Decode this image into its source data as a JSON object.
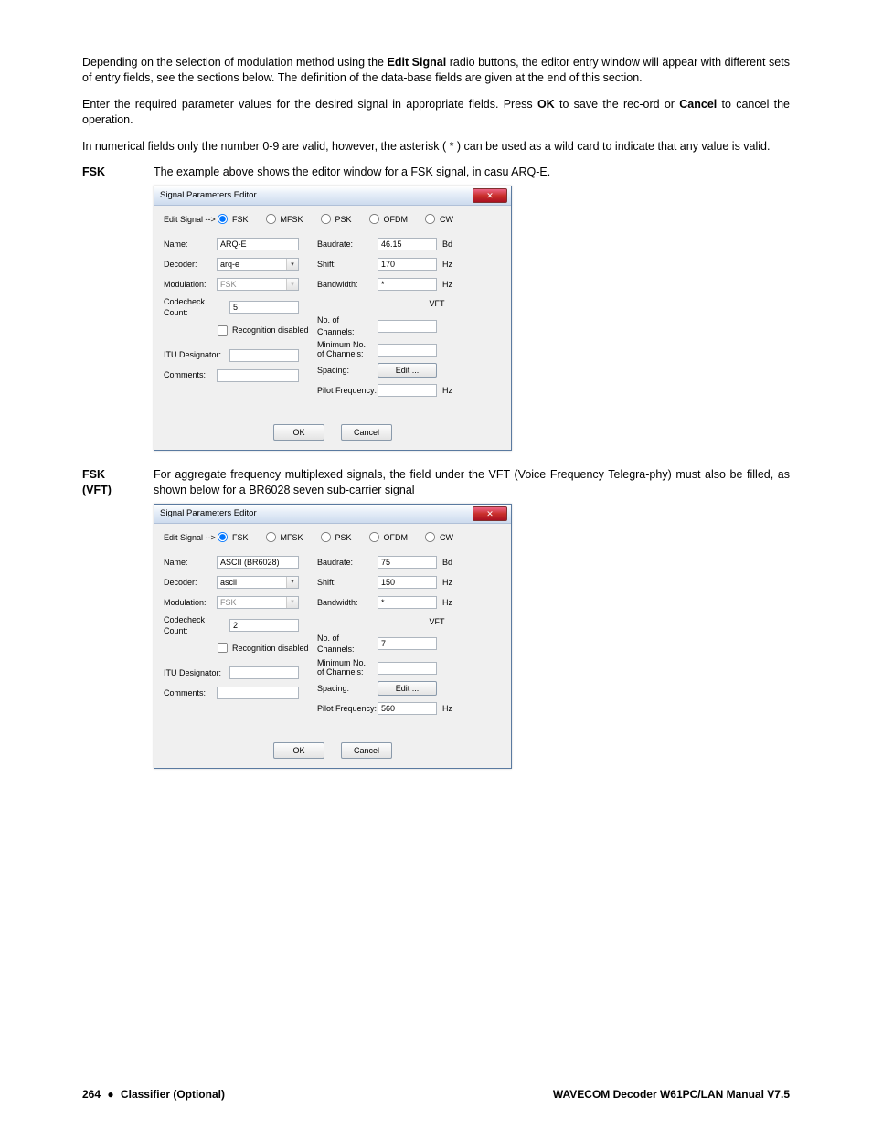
{
  "paragraphs": {
    "p1_a": "Depending on the selection of modulation method using the ",
    "p1_b": "Edit Signal",
    "p1_c": " radio buttons, the editor entry window will appear with different sets of entry fields, see the sections below. The definition of the data-base fields are given at the end of this section.",
    "p2_a": "Enter the required parameter values for the desired signal in appropriate fields. Press ",
    "p2_b": "OK",
    "p2_c": " to save the rec-ord or ",
    "p2_d": "Cancel",
    "p2_e": " to cancel the operation.",
    "p3": "In numerical fields only the number 0-9 are valid, however,  the asterisk ( * ) can be used as a wild card to indicate that any value is valid."
  },
  "sections": {
    "fsk_label": "FSK",
    "fsk_text": "The example above shows the editor window for a FSK signal, in casu ARQ-E.",
    "vft_label1": "FSK",
    "vft_label2": "(VFT)",
    "vft_text": "For aggregate frequency multiplexed signals, the field under the VFT (Voice Frequency Telegra-phy) must also be filled, as shown below for a BR6028 seven sub-carrier signal"
  },
  "dialog_labels": {
    "title": "Signal Parameters Editor",
    "edit_signal": "Edit Signal -->",
    "radio_fsk": "FSK",
    "radio_mfsk": "MFSK",
    "radio_psk": "PSK",
    "radio_ofdm": "OFDM",
    "radio_cw": "CW",
    "name": "Name:",
    "decoder": "Decoder:",
    "modulation": "Modulation:",
    "codecheck": "Codecheck Count:",
    "recognition": "Recognition disabled",
    "itu": "ITU Designator:",
    "comments": "Comments:",
    "baudrate": "Baudrate:",
    "shift": "Shift:",
    "bandwidth": "Bandwidth:",
    "vft": "VFT",
    "channels": "No. of Channels:",
    "minchannels1": "Minimum No.",
    "minchannels2": "of Channels:",
    "spacing": "Spacing:",
    "pilot": "Pilot Frequency:",
    "edit_btn": "Edit ...",
    "ok": "OK",
    "cancel": "Cancel",
    "unit_bd": "Bd",
    "unit_hz": "Hz"
  },
  "dialog1": {
    "name": "ARQ-E",
    "decoder": "arq-e",
    "modulation": "FSK",
    "codecheck": "5",
    "itu": "",
    "comments": "",
    "baudrate": "46.15",
    "shift": "170",
    "bandwidth": "*",
    "channels": "",
    "minchannels": "",
    "pilot": ""
  },
  "dialog2": {
    "name": "ASCII (BR6028)",
    "decoder": "ascii",
    "modulation": "FSK",
    "codecheck": "2",
    "itu": "",
    "comments": "",
    "comments_label_variant": "Comments:",
    "baudrate": "75",
    "shift": "150",
    "bandwidth": "*",
    "channels": "7",
    "minchannels": "",
    "pilot": "560"
  },
  "footer": {
    "page": "264",
    "section": "Classifier (Optional)",
    "product": "WAVECOM Decoder W61PC/LAN Manual V7.5"
  }
}
